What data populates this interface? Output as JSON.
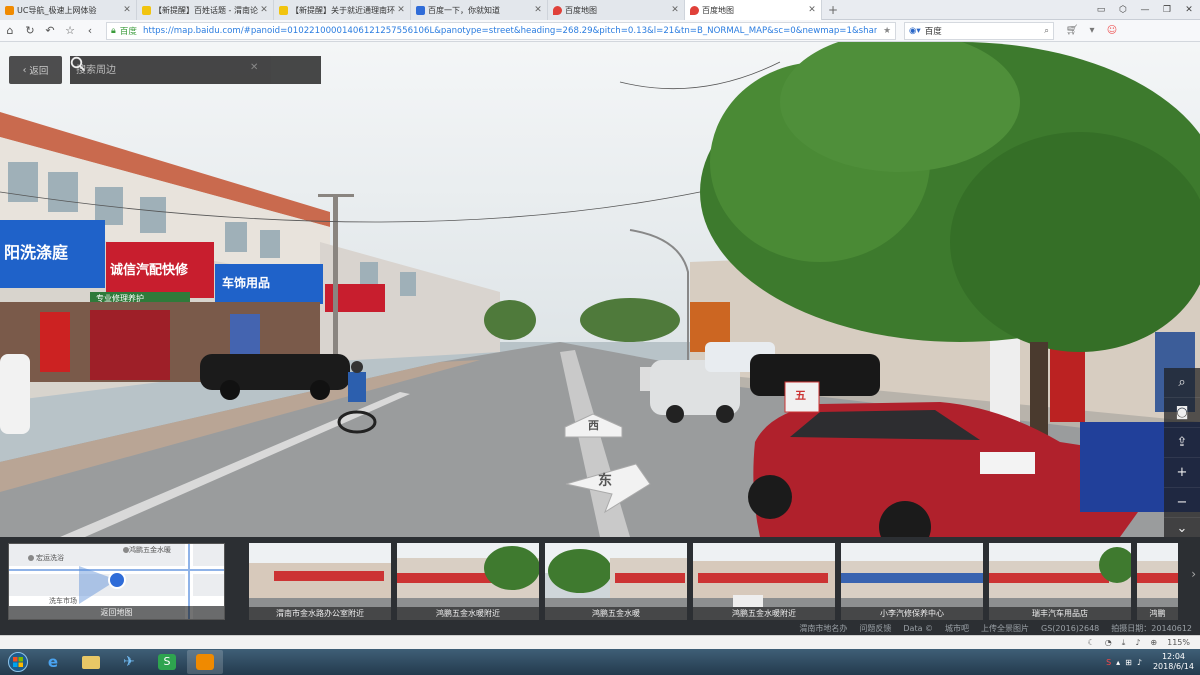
{
  "browser": {
    "tabs": [
      {
        "title": "UC导航_极速上网体验",
        "active": false,
        "fav_color": "#f08a00"
      },
      {
        "title": "【新提醒】百姓话题 - 渭南论",
        "active": false,
        "fav_color": "#f1c40f"
      },
      {
        "title": "【新提醒】关于就近通理南环",
        "active": false,
        "fav_color": "#f1c40f"
      },
      {
        "title": "百度一下，你就知道",
        "active": false,
        "fav_color": "#2f6cd8"
      },
      {
        "title": "百度地图",
        "active": false,
        "fav_color": "#e0413a"
      },
      {
        "title": "百度地图",
        "active": true,
        "fav_color": "#e0413a"
      }
    ],
    "new_tab": "+",
    "window_controls": [
      "▭",
      "⬡",
      "—",
      "❐",
      "✕"
    ],
    "site_label": "百度",
    "url": "https://map.baidu.com/#panoid=01022100001406121257556106L&panotype=street&heading=268.29&pitch=0.13&l=21&tn=B_NORMAL_MAP&sc=0&newmap=1&shareurl=1&pid=0",
    "search_engine": "百度",
    "search_placeholder": "百度"
  },
  "pano": {
    "back_label": "返回",
    "search_placeholder": "搜索周边",
    "arrow_west": "西",
    "arrow_east": "东",
    "tools": [
      "search-icon",
      "camera-icon",
      "share-icon",
      "zoom-in-icon",
      "zoom-out-icon",
      "chevron-down-icon"
    ],
    "shop_signs": [
      "阳洗涤庭",
      "诚信汽配快修",
      "车饰用品",
      "专业修理养护"
    ],
    "road_marker": "五"
  },
  "strip": {
    "minimap_label": "返回地图",
    "minimap_poi1": "鸿鹏五金水暖",
    "minimap_poi2": "宏运洗浴",
    "minimap_poi3": "洗车市场",
    "thumbnails": [
      {
        "caption": "渭南市金水路办公室附近"
      },
      {
        "caption": "鸿鹏五金水暖附近"
      },
      {
        "caption": "鸿鹏五金水暖"
      },
      {
        "caption": "鸿鹏五金水暖附近"
      },
      {
        "caption": "小李汽修保养中心"
      },
      {
        "caption": "瑞丰汽车用品店"
      },
      {
        "caption": "鸿鹏"
      }
    ]
  },
  "footer": {
    "links": [
      "渭南市地名办",
      "问题反馈",
      "Data ©",
      "城市吧",
      "上传全景图片",
      "GS(2016)2648",
      "拍摄日期：20140612"
    ]
  },
  "statusbar": {
    "zoom": "115%"
  },
  "taskbar": {
    "time": "12:04",
    "date": "2018/6/14"
  }
}
